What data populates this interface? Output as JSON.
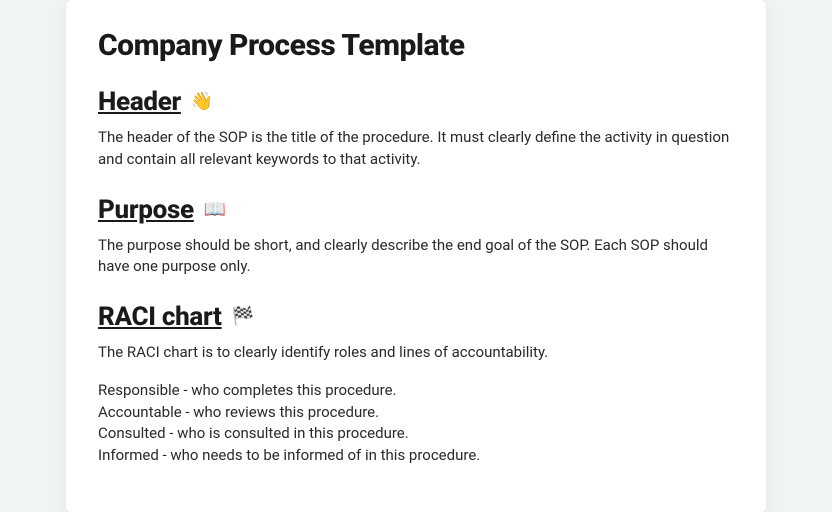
{
  "title": "Company Process Template",
  "sections": [
    {
      "heading": "Header",
      "icon": "👋",
      "body": [
        "The header of the SOP is the title of the procedure. It must clearly define the activity in question and contain all relevant keywords to that activity."
      ]
    },
    {
      "heading": "Purpose",
      "icon": "📖",
      "body": [
        "The purpose should be short, and clearly describe the end goal of the SOP. Each SOP should have one purpose only."
      ]
    },
    {
      "heading": "RACI chart",
      "icon": "🏁",
      "body": [
        "The RACI chart is to clearly identify roles and lines of accountability.",
        "",
        "Responsible - who completes this procedure.",
        "Accountable - who reviews this procedure.",
        "Consulted - who is consulted in this procedure.",
        "Informed - who needs to be informed of in this procedure."
      ]
    }
  ]
}
